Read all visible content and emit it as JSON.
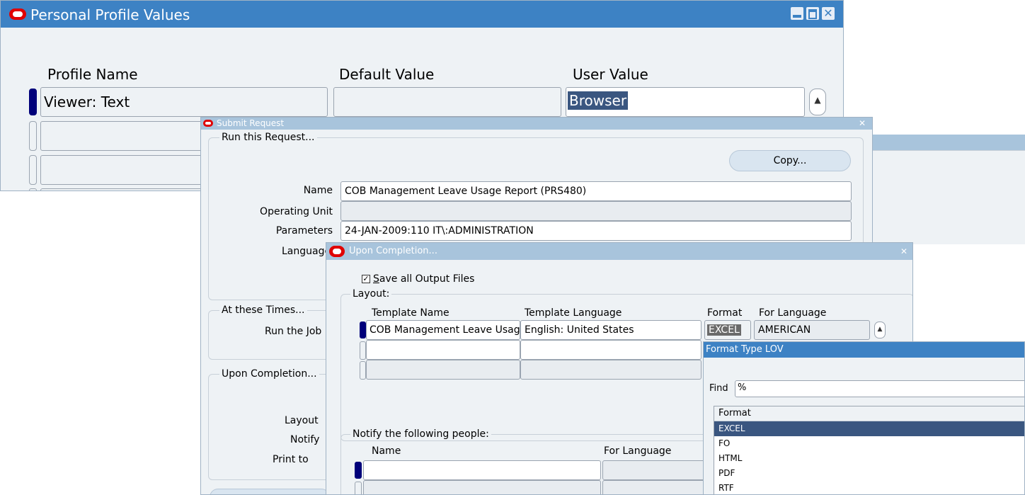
{
  "profile_window": {
    "title": "Personal Profile Values",
    "columns": {
      "profile_name": "Profile Name",
      "default_value": "Default Value",
      "user_value": "User Value"
    },
    "rows": [
      {
        "profile_name": "Viewer: Text",
        "default_value": "",
        "user_value": "Browser"
      },
      {
        "profile_name": "",
        "default_value": "",
        "user_value": ""
      },
      {
        "profile_name": "",
        "default_value": "",
        "user_value": ""
      }
    ]
  },
  "submit_window": {
    "title": "Submit Request",
    "run_group": "Run this Request...",
    "copy_button": "Copy...",
    "name_label": "Name",
    "name_value": "COB Management Leave Usage Report (PRS480)",
    "operating_unit_label": "Operating Unit",
    "operating_unit_value": "",
    "parameters_label": "Parameters",
    "parameters_value": "24-JAN-2009:110  IT\\:ADMINISTRATION",
    "language_label": "Language",
    "times_group": "At these Times...",
    "run_job_label": "Run the Job",
    "completion_group": "Upon Completion...",
    "layout_label": "Layout",
    "notify_label": "Notify",
    "print_label": "Print to"
  },
  "completion_window": {
    "title": "Upon Completion...",
    "save_output_label": "Save all Output Files",
    "save_output_checked": true,
    "layout_group": "Layout:",
    "columns": {
      "template_name": "Template Name",
      "template_language": "Template Language",
      "format": "Format",
      "for_language": "For Language"
    },
    "layout_rows": [
      {
        "template_name": "COB Management Leave Usage",
        "template_language": "English: United States",
        "format": "EXCEL",
        "for_language": "AMERICAN"
      },
      {
        "template_name": "",
        "template_language": "",
        "format": "",
        "for_language": ""
      },
      {
        "template_name": "",
        "template_language": "",
        "format": "",
        "for_language": ""
      }
    ],
    "notify_group": "Notify the following people:",
    "notify_columns": {
      "name": "Name",
      "for_language": "For Language"
    }
  },
  "lov_window": {
    "title": "Format Type LOV",
    "find_label": "Find",
    "find_value": "%",
    "column": "Format",
    "options": [
      "EXCEL",
      "FO",
      "HTML",
      "PDF",
      "RTF"
    ],
    "selected": "EXCEL"
  },
  "colors": {
    "titlebar_active": "#3d82c4",
    "titlebar_inactive": "#a8c4dc",
    "window_bg": "#eef2f5",
    "selection": "#3a5680",
    "row_indicator": "#00007a",
    "oracle_red": "#e00000"
  },
  "icons": [
    "oracle-logo-icon",
    "minimize-icon",
    "maximize-icon",
    "close-icon",
    "scroll-up-icon",
    "checkbox-checked-icon"
  ]
}
